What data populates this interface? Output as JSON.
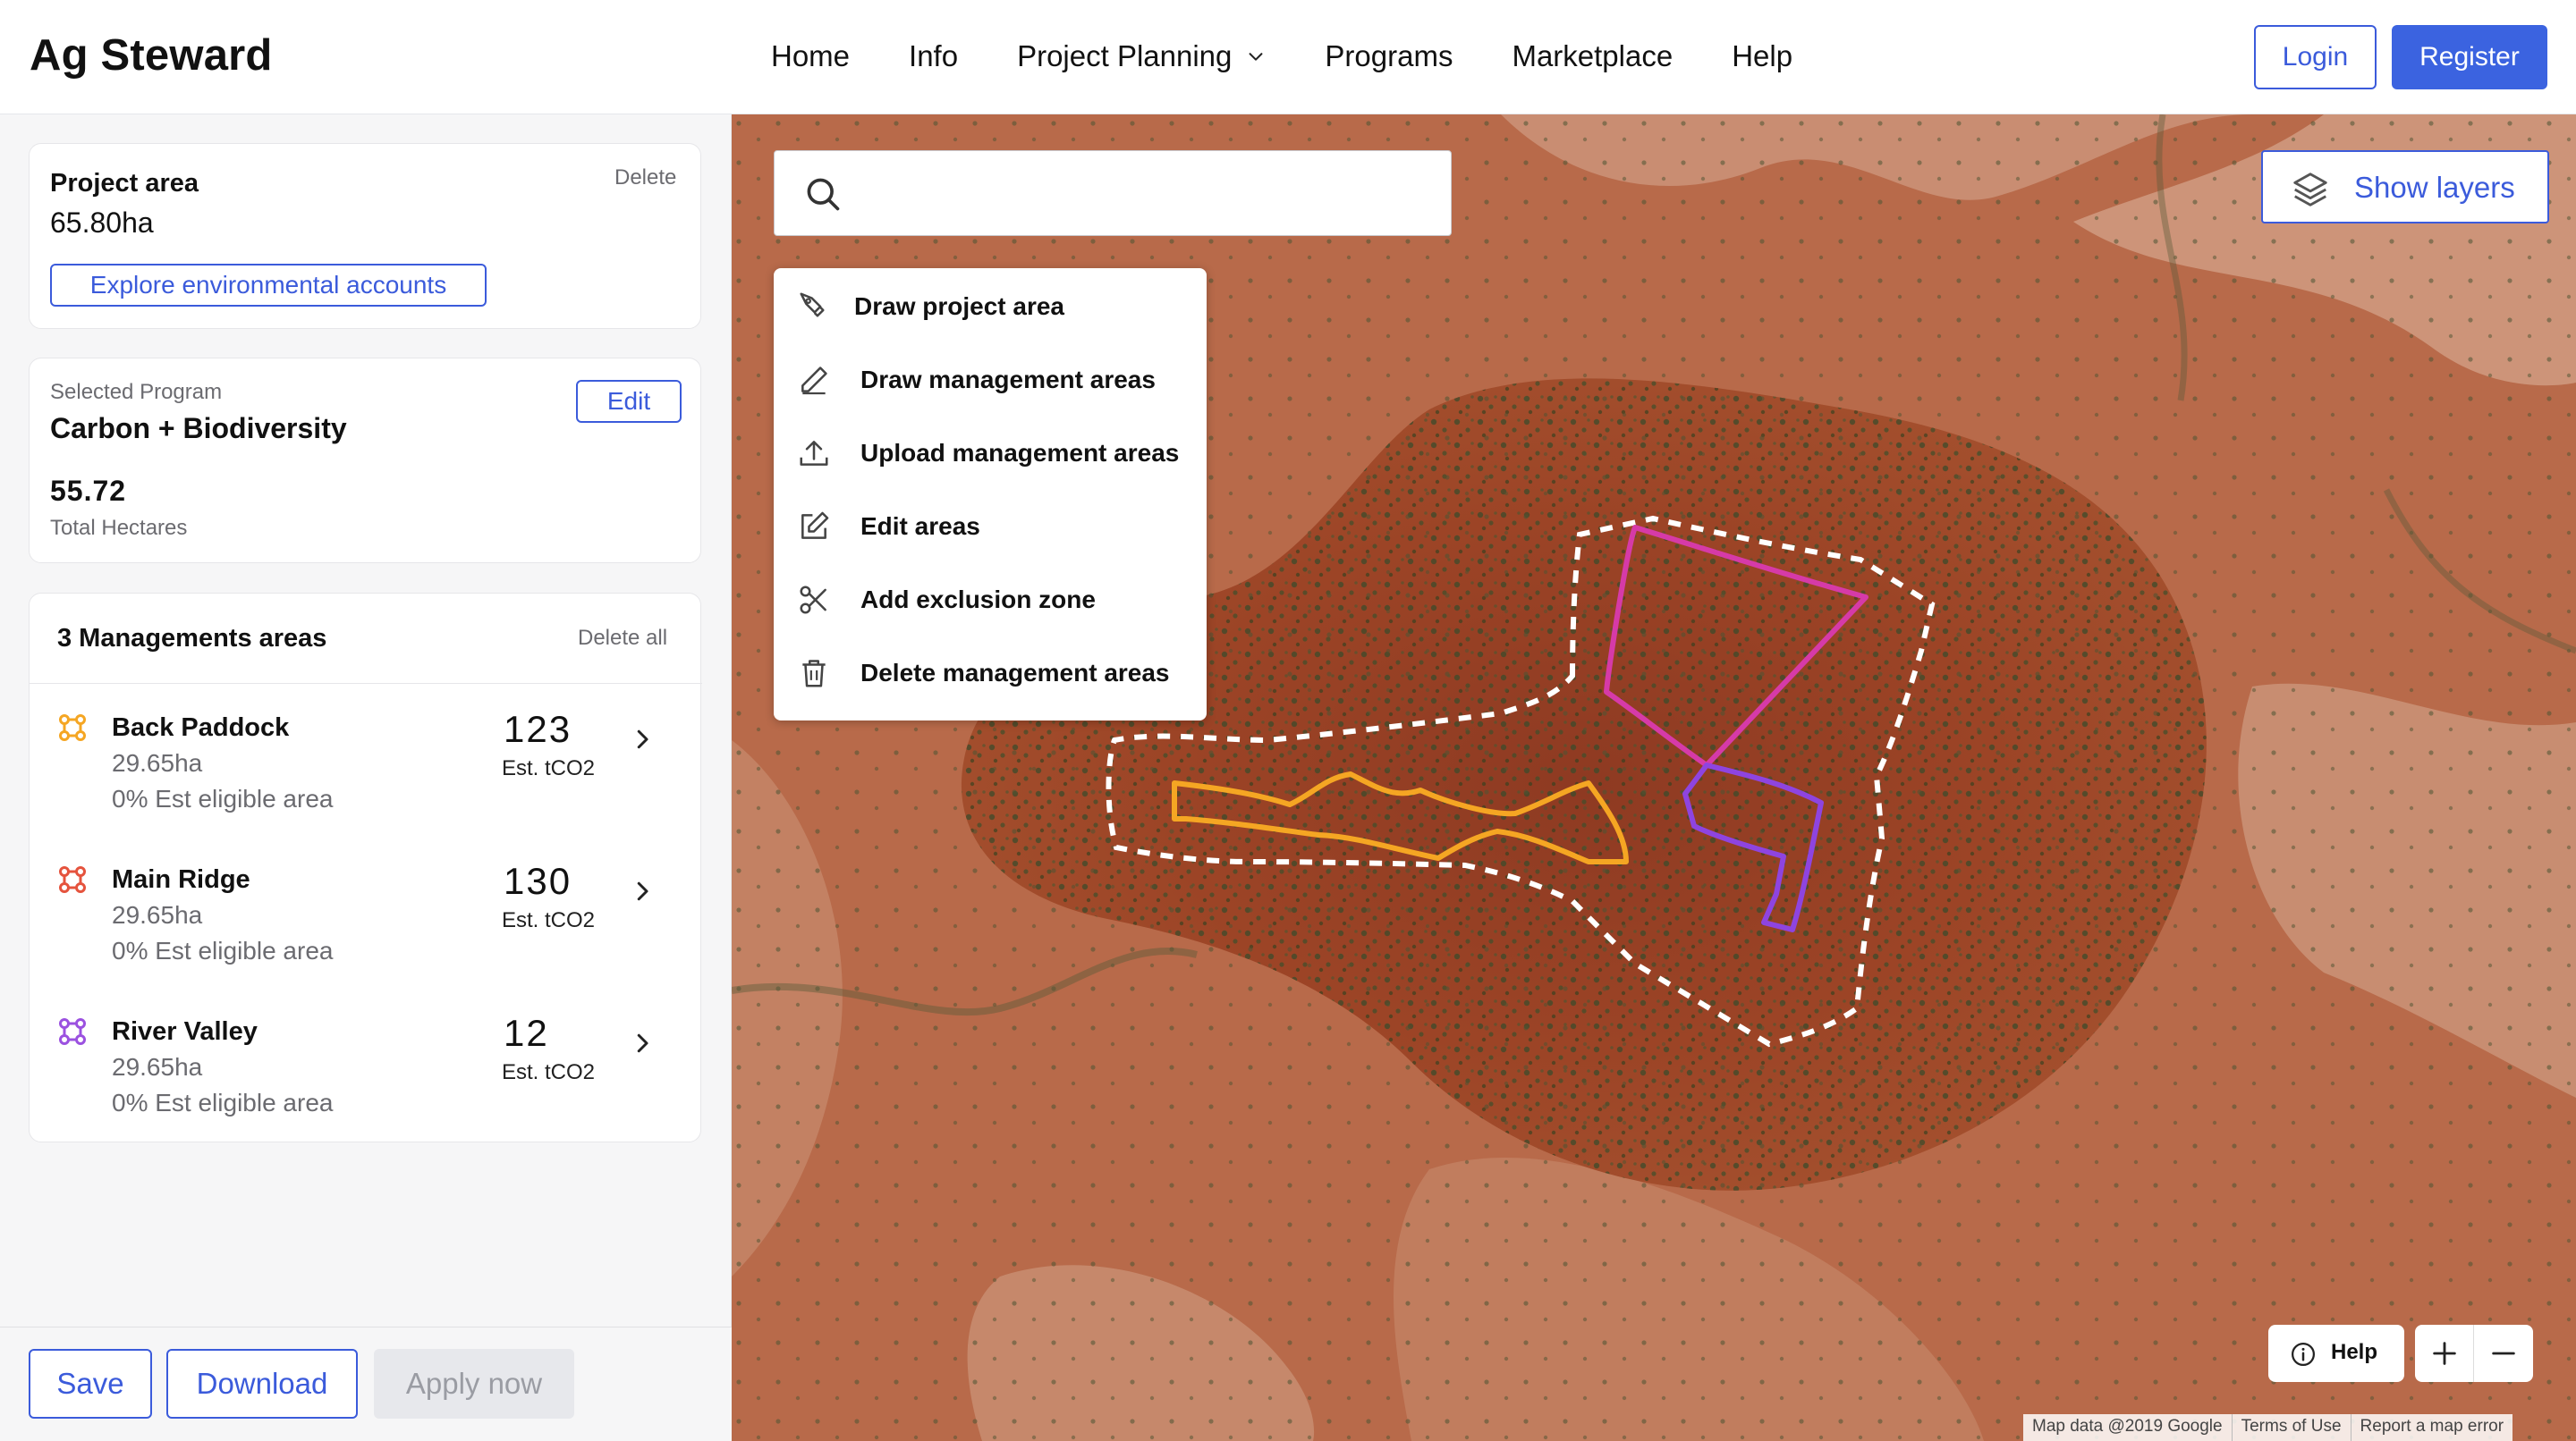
{
  "app": {
    "title": "Ag Steward"
  },
  "nav": {
    "items": [
      {
        "label": "Home"
      },
      {
        "label": "Info"
      },
      {
        "label": "Project Planning",
        "has_dropdown": true
      },
      {
        "label": "Programs"
      },
      {
        "label": "Marketplace"
      },
      {
        "label": "Help"
      }
    ],
    "login_label": "Login",
    "register_label": "Register"
  },
  "project_card": {
    "title": "Project area",
    "delete_label": "Delete",
    "area": "65.80ha",
    "explore_label": "Explore environmental accounts"
  },
  "program_card": {
    "caption": "Selected Program",
    "name": "Carbon + Biodiversity",
    "edit_label": "Edit",
    "hectares": "55.72",
    "hectares_label": "Total Hectares"
  },
  "management": {
    "title": "3 Managements areas",
    "delete_all_label": "Delete all",
    "areas": [
      {
        "name": "Back Paddock",
        "hectares": "29.65ha",
        "eligible": "0% Est eligible area",
        "value": "123",
        "unit": "Est. tCO2",
        "color": "#f5a623"
      },
      {
        "name": "Main Ridge",
        "hectares": "29.65ha",
        "eligible": "0% Est eligible area",
        "value": "130",
        "unit": "Est. tCO2",
        "color": "#e5533d"
      },
      {
        "name": "River Valley",
        "hectares": "29.65ha",
        "eligible": "0% Est eligible area",
        "value": "12",
        "unit": "Est. tCO2",
        "color": "#9b51e0"
      }
    ]
  },
  "footer": {
    "save_label": "Save",
    "download_label": "Download",
    "apply_label": "Apply now"
  },
  "map": {
    "search": {
      "placeholder": ""
    },
    "tools": [
      {
        "label": "Draw project area",
        "icon": "pen-tool-icon"
      },
      {
        "label": "Draw management areas",
        "icon": "pencil-icon"
      },
      {
        "label": "Upload management areas",
        "icon": "upload-icon"
      },
      {
        "label": "Edit areas",
        "icon": "edit-square-icon"
      },
      {
        "label": "Add exclusion zone",
        "icon": "scissors-icon"
      },
      {
        "label": "Delete management areas",
        "icon": "trash-icon"
      }
    ],
    "layers_label": "Show layers",
    "help_label": "Help",
    "attribution": {
      "map_data": "Map data @2019 Google",
      "terms": "Terms of Use",
      "report": "Report a map error"
    },
    "colors": {
      "project_outline": "#ffffff",
      "area_orange": "#f5a623",
      "area_magenta": "#d63aa8",
      "area_purple": "#8e44e0"
    }
  },
  "colors": {
    "accent": "#3b5bdb",
    "sidebar_bg": "#f6f6f7"
  }
}
